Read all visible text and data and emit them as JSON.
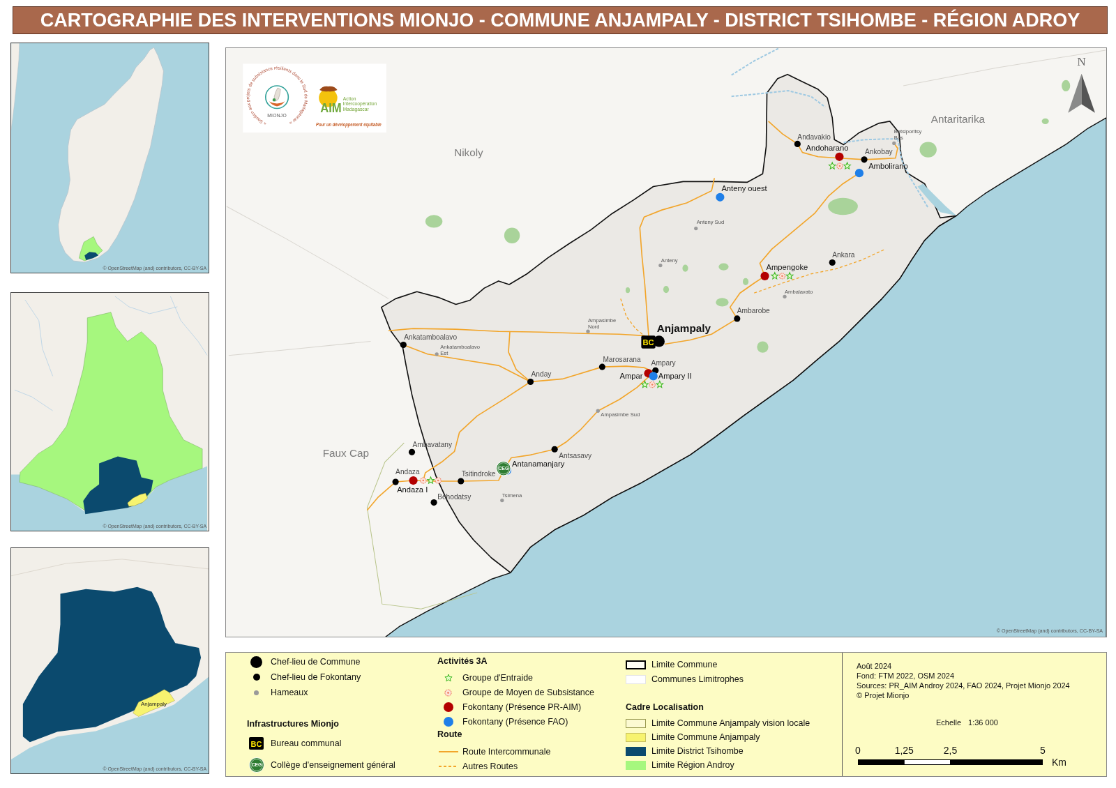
{
  "title": "CARTOGRAPHIE DES INTERVENTIONS MIONJO - COMMUNE ANJAMPALY - DISTRICT TSIHOMBE - RÉGION ADROY",
  "location_maps": [
    {
      "kind": "country",
      "attribution": "© OpenStreetMap (and) contributors, CC-BY-SA"
    },
    {
      "kind": "region",
      "attribution": "© OpenStreetMap (and) contributors, CC-BY-SA"
    },
    {
      "kind": "district",
      "label": "Anjampaly",
      "attribution": "© OpenStreetMap (and) contributors, CC-BY-SA"
    }
  ],
  "map": {
    "logos": [
      {
        "kind": "mionjo",
        "motto": "« Soutien aux projets de subsistance résilients dans le Sud de Madagascar »",
        "name": "MIONJO"
      },
      {
        "kind": "aim",
        "name": "AIM",
        "lines": [
          "Action",
          "Intercoopération",
          "Madagascar"
        ],
        "motto": "Pour un développement équitable"
      }
    ],
    "north": "N",
    "areas": [
      "Nikoly",
      "Antaritarika",
      "Faux Cap"
    ],
    "places": [
      {
        "name": "Andavakio",
        "kind": "fokontany"
      },
      {
        "name": "Betsiporitsy Bas",
        "kind": "hamlet"
      },
      {
        "name": "Andoharano",
        "kind": "pr_aim",
        "activities": [
          {
            "kind": "entraide"
          },
          {
            "kind": "subsistance"
          },
          {
            "kind": "entraide"
          }
        ]
      },
      {
        "name": "Ankobay",
        "kind": "fokontany"
      },
      {
        "name": "Ambolirano",
        "kind": "fao"
      },
      {
        "name": "Anteny ouest",
        "kind": "fao"
      },
      {
        "name": "Anteny Sud",
        "kind": "hamlet"
      },
      {
        "name": "Ankara",
        "kind": "fokontany"
      },
      {
        "name": "Anteny",
        "kind": "hamlet"
      },
      {
        "name": "Ampengoke",
        "kind": "pr_aim",
        "activities": [
          {
            "kind": "entraide"
          },
          {
            "kind": "subsistance"
          },
          {
            "kind": "entraide"
          }
        ]
      },
      {
        "name": "Ambalavato",
        "kind": "hamlet"
      },
      {
        "name": "Ambarobe",
        "kind": "fokontany"
      },
      {
        "name": "Ampasimbe Nord",
        "kind": "hamlet"
      },
      {
        "name": "Ankatamboalavo",
        "kind": "fokontany"
      },
      {
        "name": "Anjampaly",
        "kind": "commune",
        "facility": {
          "kind": "bc",
          "badge": "BC"
        }
      },
      {
        "name": "Ankatamboalavo Est",
        "kind": "hamlet"
      },
      {
        "name": "Marosarana",
        "kind": "fokontany"
      },
      {
        "name": "Ampary",
        "kind": "fokontany"
      },
      {
        "name": "Anday",
        "kind": "fokontany"
      },
      {
        "name": "Ampar",
        "kind": "pr_aim"
      },
      {
        "name": "Ampary II",
        "kind": "fao",
        "activities": [
          {
            "kind": "entraide"
          },
          {
            "kind": "subsistance"
          },
          {
            "kind": "entraide"
          }
        ]
      },
      {
        "name": "Ampasimbe Sud",
        "kind": "hamlet"
      },
      {
        "name": "Ambavatany",
        "kind": "fokontany"
      },
      {
        "name": "Antsasavy",
        "kind": "fokontany"
      },
      {
        "name": "Antanamanjary",
        "kind": "fao",
        "facility": {
          "kind": "ceg",
          "badge": "CEG"
        }
      },
      {
        "name": "Andaza",
        "kind": "fokontany"
      },
      {
        "name": "Tsitindroke",
        "kind": "fokontany"
      },
      {
        "name": "Andaza I",
        "kind": "pr_aim",
        "activities": [
          {
            "kind": "subsistance"
          },
          {
            "kind": "entraide"
          },
          {
            "kind": "subsistance"
          }
        ]
      },
      {
        "name": "Behodatsy",
        "kind": "fokontany"
      },
      {
        "name": "Tsimena",
        "kind": "hamlet"
      }
    ],
    "attribution": "© OpenStreetMap (and) contributors, CC-BY-SA"
  },
  "legend": {
    "columns": [
      {
        "sections": [
          {
            "items": [
              {
                "kind": "commune",
                "label": "Chef-lieu de Commune"
              },
              {
                "kind": "fokontany",
                "label": "Chef-lieu de Fokontany"
              },
              {
                "kind": "hamlet",
                "label": "Hameaux"
              }
            ]
          },
          {
            "heading": "Infrastructures Mionjo",
            "items": [
              {
                "kind": "bc",
                "badge": "BC",
                "label": "Bureau communal"
              },
              {
                "kind": "ceg",
                "badge": "CEG",
                "label": "Collège d'enseignement général"
              }
            ]
          }
        ]
      },
      {
        "sections": [
          {
            "heading": "Activités 3A",
            "items": [
              {
                "kind": "entraide",
                "label": "Groupe d'Entraide"
              },
              {
                "kind": "subsistance",
                "label": "Groupe de Moyen de Subsistance"
              },
              {
                "kind": "pr_aim",
                "label": "Fokontany (Présence PR-AIM)"
              },
              {
                "kind": "fao",
                "label": "Fokontany (Présence FAO)"
              }
            ]
          },
          {
            "heading": "Route",
            "items": [
              {
                "kind": "road_main",
                "label": "Route Intercommunale"
              },
              {
                "kind": "road_other",
                "label": "Autres Routes"
              }
            ]
          }
        ]
      },
      {
        "sections": [
          {
            "items": [
              {
                "kind": "commune_limit",
                "label": "Limite Commune"
              },
              {
                "kind": "neighbour_limit",
                "label": "Communes Limitrophes"
              }
            ]
          },
          {
            "heading": "Cadre Localisation",
            "items": [
              {
                "kind": "local_vision",
                "label": "Limite Commune Anjampaly vision locale"
              },
              {
                "kind": "commune_area",
                "label": "Limite Commune Anjampaly"
              },
              {
                "kind": "district_area",
                "label": "Limite District Tsihombe"
              },
              {
                "kind": "region_area",
                "label": "Limite Région Androy"
              }
            ]
          }
        ]
      }
    ],
    "notes": [
      "Août 2024",
      "Fond: FTM 2022, OSM 2024",
      "Sources: PR_AIM Androy 2024, FAO 2024, Projet Mionjo 2024",
      "© Projet Mionjo"
    ],
    "scale": {
      "label": "Echelle",
      "ratio": "1:36 000",
      "ticks": [
        "0",
        "1,25",
        "2,5",
        "5"
      ],
      "unit": "Km"
    }
  }
}
